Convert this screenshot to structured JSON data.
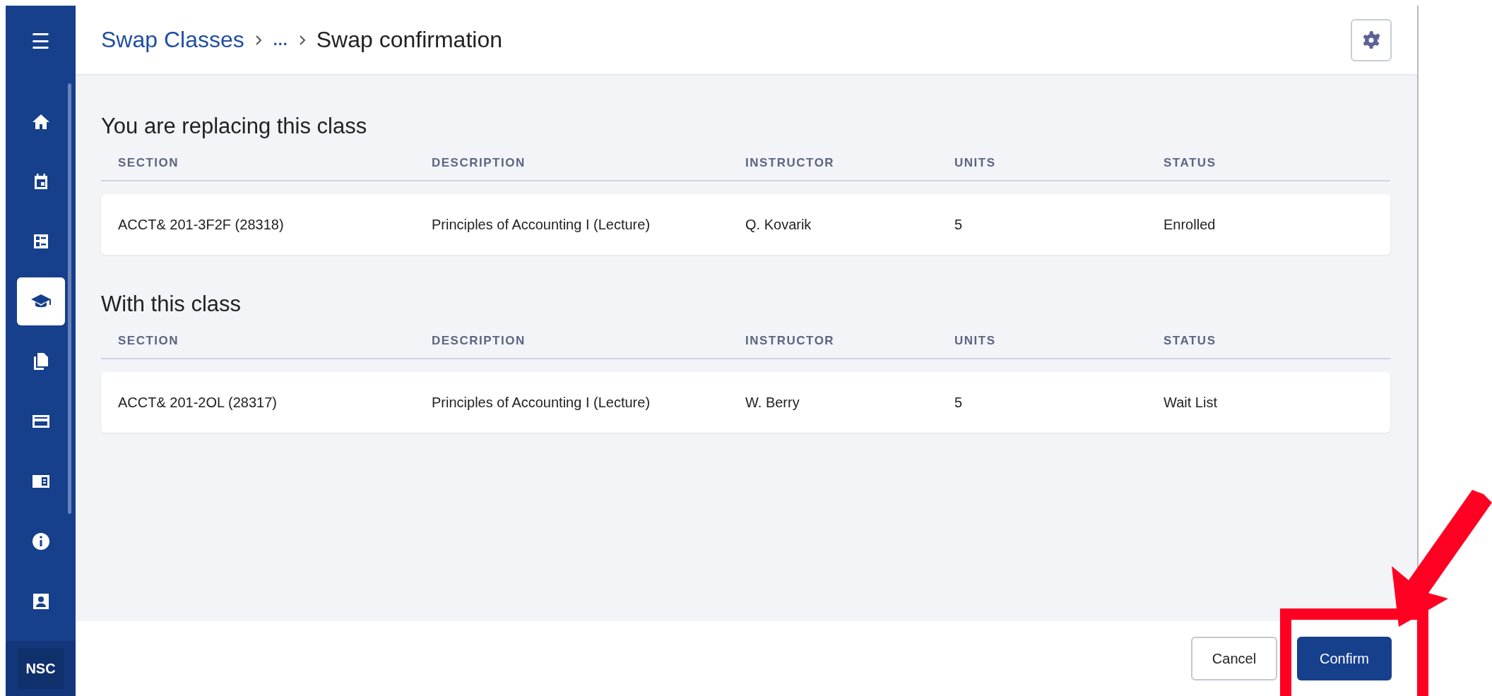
{
  "sidebar": {
    "menu_button": {
      "label": "☰"
    },
    "items": [
      {
        "selected": false
      },
      {
        "selected": false
      },
      {
        "selected": false
      },
      {
        "selected": true
      },
      {
        "selected": false
      },
      {
        "selected": false
      },
      {
        "selected": false
      },
      {
        "selected": false
      },
      {
        "selected": false
      }
    ],
    "badge": "NSC"
  },
  "header": {
    "breadcrumb": [
      {
        "label": "Swap Classes",
        "kind": "link"
      },
      {
        "label": "…",
        "kind": "link"
      },
      {
        "label": "Swap confirmation",
        "kind": "current"
      }
    ]
  },
  "sections": [
    {
      "title": "You are replacing this class",
      "columns": [
        "SECTION",
        "DESCRIPTION",
        "INSTRUCTOR",
        "UNITS",
        "STATUS"
      ],
      "rows": [
        [
          "ACCT& 201-3F2F (28318)",
          "Principles of Accounting I (Lecture)",
          "Q. Kovarik",
          "5",
          "Enrolled"
        ]
      ]
    },
    {
      "title": "With this class",
      "columns": [
        "SECTION",
        "DESCRIPTION",
        "INSTRUCTOR",
        "UNITS",
        "STATUS"
      ],
      "rows": [
        [
          "ACCT& 201-2OL (28317)",
          "Principles of Accounting I (Lecture)",
          "W. Berry",
          "5",
          "Wait List"
        ]
      ]
    }
  ],
  "footer": {
    "buttons": [
      {
        "label": "Cancel",
        "kind": "secondary"
      },
      {
        "label": "Confirm",
        "kind": "primary"
      }
    ]
  },
  "annotation": {
    "kind": "arrow-frame"
  }
}
